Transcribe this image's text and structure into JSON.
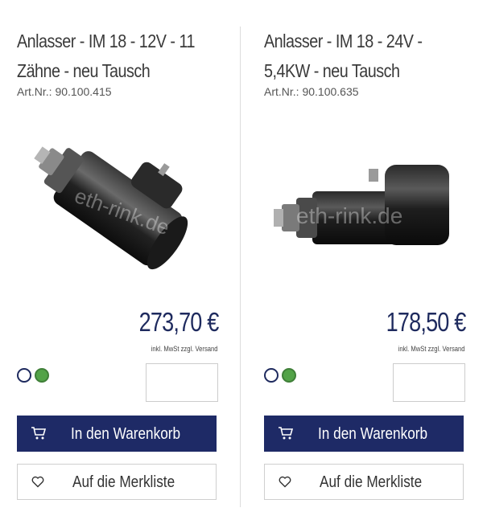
{
  "products": [
    {
      "title": "Anlasser - IM 18 - 12V - 11 Zähne - neu Tausch",
      "artnr": "Art.Nr.: 90.100.415",
      "watermark": "eth-rink.de",
      "price": "273,70 €",
      "tax_note": "inkl. MwSt zzgl. Versand",
      "quantity": "",
      "cart_label": "In den Warenkorb",
      "wishlist_label": "Auf die Merkliste"
    },
    {
      "title": "Anlasser - IM 18 - 24V - 5,4KW - neu Tausch",
      "artnr": "Art.Nr.: 90.100.635",
      "watermark": "eth-rink.de",
      "price": "178,50 €",
      "tax_note": "inkl. MwSt zzgl. Versand",
      "quantity": "",
      "cart_label": "In den Warenkorb",
      "wishlist_label": "Auf die Merkliste"
    }
  ],
  "colors": {
    "brand_navy": "#1e2a66",
    "indicator_green": "#53a348"
  },
  "icons": {
    "cart": "cart-icon",
    "wishlist": "heart-icon"
  }
}
